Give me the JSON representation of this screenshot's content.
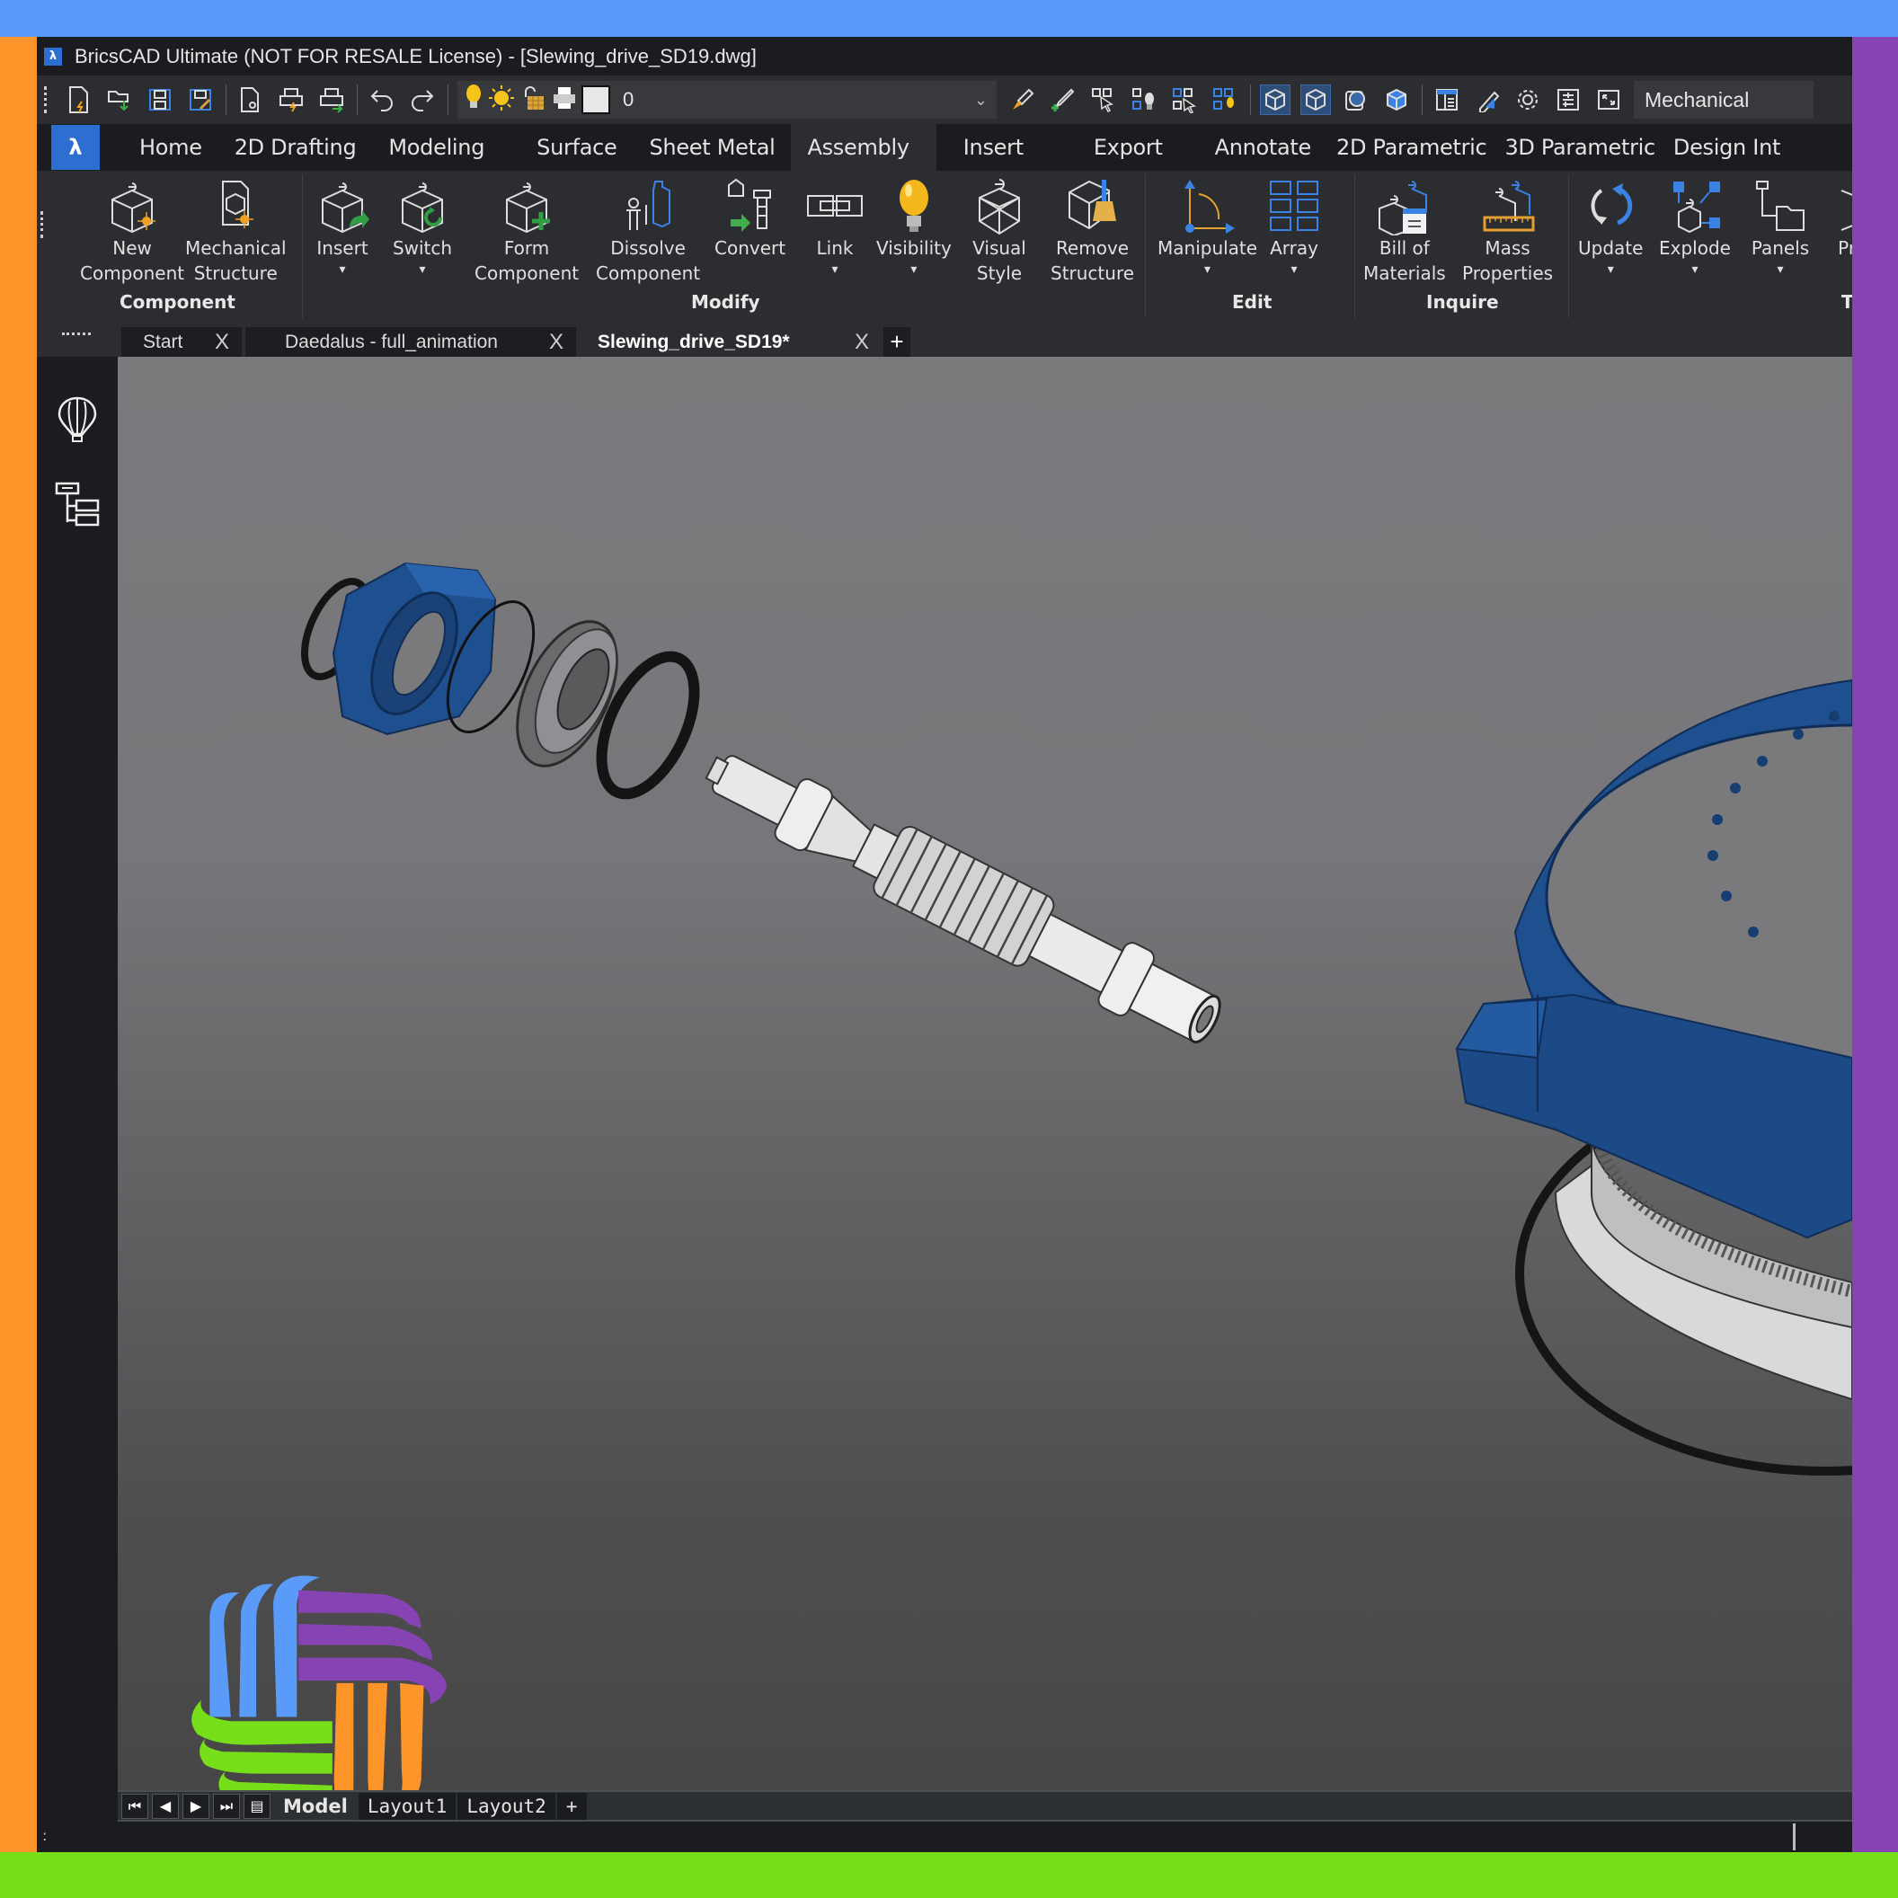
{
  "window": {
    "title": "BricsCAD Ultimate (NOT FOR RESALE License) - [Slewing_drive_SD19.dwg]",
    "app_icon": "bricscad-logo"
  },
  "frame_colors": {
    "top": "#5a9af8",
    "left": "#fd952a",
    "right": "#8643b3",
    "bottom": "#77de1a"
  },
  "toolbar": {
    "icons": [
      "new-file-icon",
      "open-file-icon",
      "save-icon",
      "save-as-icon",
      "print-preview-icon",
      "plot-icon",
      "publish-icon",
      "undo-icon",
      "redo-icon"
    ],
    "layer_icons": [
      "layer-on-bulb-icon",
      "layer-freeze-sun-icon",
      "layer-lock-icon",
      "layer-plot-icon"
    ],
    "layer_value": "0",
    "right_icons": [
      "match-properties-icon",
      "add-selected-icon",
      "select-similar-icon",
      "isolate-icon",
      "select-icon",
      "quick-select-icon",
      "view-cube-icon",
      "view-cube-2-icon",
      "render-icon",
      "shade-icon",
      "properties-panel-icon",
      "drawing-explorer-icon",
      "settings-icon",
      "layers-panel-icon",
      "fullscreen-icon"
    ],
    "workspace": "Mechanical"
  },
  "ribbon": {
    "tabs": [
      {
        "label": "Home",
        "active": false
      },
      {
        "label": "2D Drafting",
        "active": false
      },
      {
        "label": "Modeling",
        "active": false
      },
      {
        "label": "Surface",
        "active": false
      },
      {
        "label": "Sheet Metal",
        "active": false
      },
      {
        "label": "Assembly",
        "active": true
      },
      {
        "label": "Insert",
        "active": false
      },
      {
        "label": "Export",
        "active": false
      },
      {
        "label": "Annotate",
        "active": false
      },
      {
        "label": "2D Parametric",
        "active": false
      },
      {
        "label": "3D Parametric",
        "active": false
      },
      {
        "label": "Design Int",
        "active": false
      }
    ],
    "groups": [
      {
        "label": "Component"
      },
      {
        "label": "Modify"
      },
      {
        "label": "Edit"
      },
      {
        "label": "Inquire"
      },
      {
        "label": "T"
      }
    ],
    "buttons": [
      {
        "line1": "New",
        "line2": "Component",
        "icon": "new-component-icon"
      },
      {
        "line1": "Mechanical",
        "line2": "Structure",
        "icon": "mechanical-structure-icon"
      },
      {
        "line1": "Insert",
        "line2": "▾",
        "icon": "insert-component-icon"
      },
      {
        "line1": "Switch",
        "line2": "▾",
        "icon": "switch-component-icon"
      },
      {
        "line1": "Form",
        "line2": "Component",
        "icon": "form-component-icon"
      },
      {
        "line1": "Dissolve",
        "line2": "Component",
        "icon": "dissolve-component-icon"
      },
      {
        "line1": "Convert",
        "line2": "",
        "icon": "convert-icon"
      },
      {
        "line1": "Link",
        "line2": "▾",
        "icon": "link-icon"
      },
      {
        "line1": "Visibility",
        "line2": "▾",
        "icon": "visibility-bulb-icon"
      },
      {
        "line1": "Visual",
        "line2": "Style",
        "icon": "visual-style-icon"
      },
      {
        "line1": "Remove",
        "line2": "Structure",
        "icon": "remove-structure-icon"
      },
      {
        "line1": "Manipulate",
        "line2": "▾",
        "icon": "manipulate-icon"
      },
      {
        "line1": "Array",
        "line2": "▾",
        "icon": "array-icon"
      },
      {
        "line1": "Bill of",
        "line2": "Materials",
        "icon": "bill-of-materials-icon"
      },
      {
        "line1": "Mass",
        "line2": "Properties",
        "icon": "mass-properties-icon"
      },
      {
        "line1": "Update",
        "line2": "▾",
        "icon": "update-icon"
      },
      {
        "line1": "Explode",
        "line2": "▾",
        "icon": "explode-icon"
      },
      {
        "line1": "Panels",
        "line2": "▾",
        "icon": "panels-icon"
      },
      {
        "line1": "Pro",
        "line2": "",
        "icon": "properties-icon"
      }
    ]
  },
  "document_tabs": [
    {
      "label": "Start",
      "active": false
    },
    {
      "label": "Daedalus - full_animation",
      "active": false
    },
    {
      "label": "Slewing_drive_SD19*",
      "active": true
    }
  ],
  "new_tab_label": "+",
  "close_label": "X",
  "side_panel": {
    "icons": [
      "hot-air-balloon-icon",
      "mechanical-browser-tree-icon"
    ]
  },
  "viewport": {
    "scene": "Exploded slewing drive assembly: blue bearing housing, O-rings, ball bearing, seal, worm shaft, blue slewing housing and gear ring",
    "model_colors": {
      "housing": "#1f4f8f",
      "shaft": "#e6e6e6",
      "seal": "#1a1a1a"
    }
  },
  "watermark": {
    "name": "woven-logo",
    "colors": [
      "#5a9af8",
      "#8643b3",
      "#fd952a",
      "#77de1a"
    ]
  },
  "layout_bar": {
    "nav_buttons": [
      "first-layout-icon",
      "previous-layout-icon",
      "next-layout-icon",
      "last-layout-icon",
      "layout-list-icon"
    ],
    "tabs": [
      {
        "label": "Model",
        "active": true
      },
      {
        "label": "Layout1",
        "active": false
      },
      {
        "label": "Layout2",
        "active": false
      }
    ],
    "add_label": "+"
  },
  "command_line": {
    "prompt": ":"
  }
}
